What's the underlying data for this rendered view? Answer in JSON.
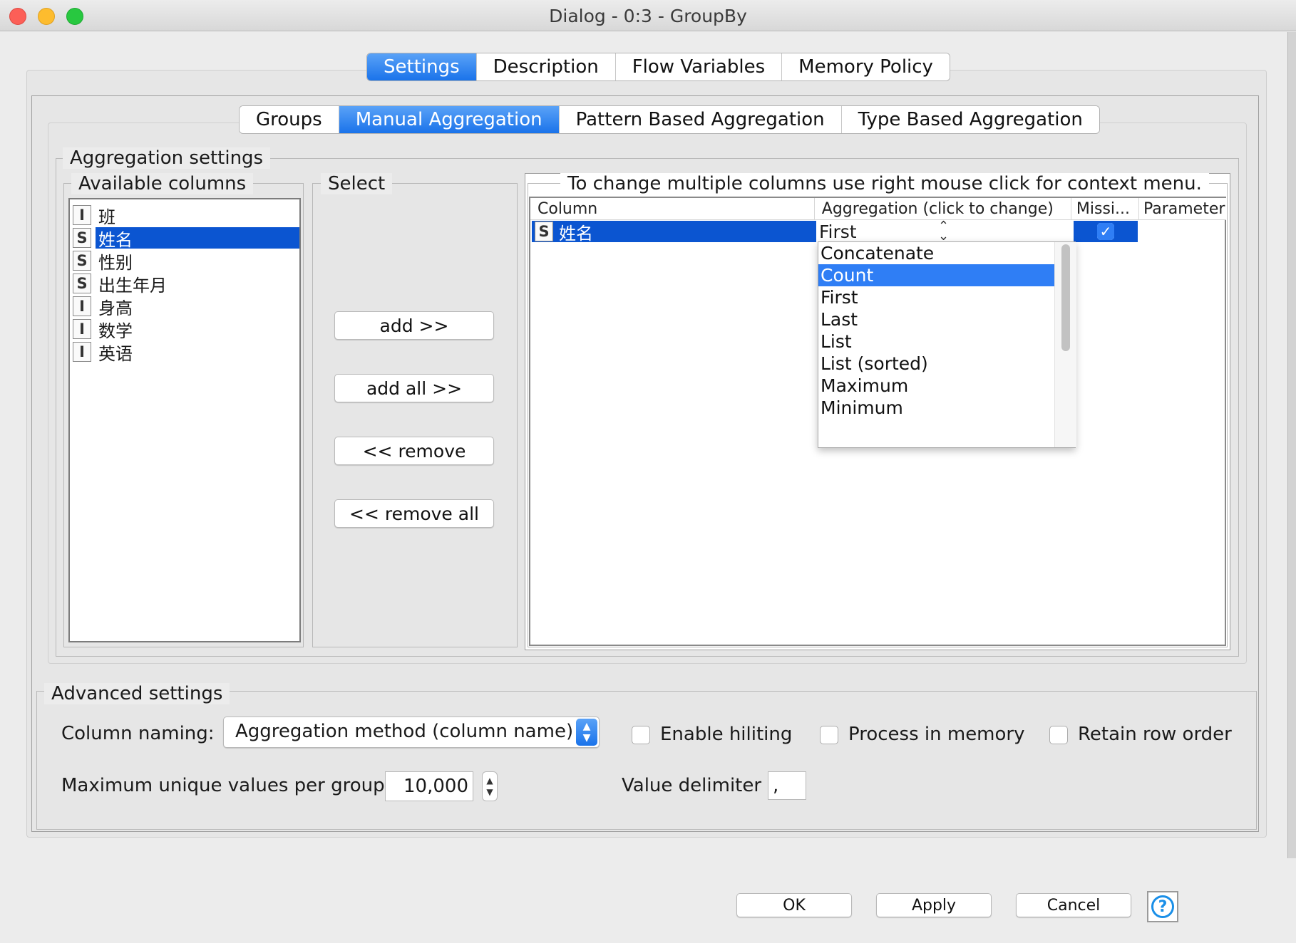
{
  "window": {
    "title": "Dialog - 0:3 - GroupBy"
  },
  "main_tabs": [
    {
      "label": "Settings",
      "active": true
    },
    {
      "label": "Description",
      "active": false
    },
    {
      "label": "Flow Variables",
      "active": false
    },
    {
      "label": "Memory Policy",
      "active": false
    }
  ],
  "sub_tabs": [
    {
      "label": "Groups",
      "active": false
    },
    {
      "label": "Manual Aggregation",
      "active": true
    },
    {
      "label": "Pattern Based Aggregation",
      "active": false
    },
    {
      "label": "Type Based Aggregation",
      "active": false
    }
  ],
  "aggregation_settings": {
    "legend": "Aggregation settings",
    "available_columns": {
      "legend": "Available columns",
      "items": [
        {
          "type": "I",
          "name": "班",
          "selected": false
        },
        {
          "type": "S",
          "name": "姓名",
          "selected": true
        },
        {
          "type": "S",
          "name": "性别",
          "selected": false
        },
        {
          "type": "S",
          "name": "出生年月",
          "selected": false
        },
        {
          "type": "I",
          "name": "身高",
          "selected": false
        },
        {
          "type": "I",
          "name": "数学",
          "selected": false
        },
        {
          "type": "I",
          "name": "英语",
          "selected": false
        }
      ]
    },
    "select": {
      "legend": "Select",
      "add": "add >>",
      "add_all": "add all >>",
      "remove": "<< remove",
      "remove_all": "<< remove all"
    },
    "table": {
      "legend": "To change multiple columns use right mouse click for context menu.",
      "headers": {
        "column": "Column",
        "aggregation": "Aggregation (click to change)",
        "missing": "Missi...",
        "parameter": "Parameter"
      },
      "row": {
        "type": "S",
        "column": "姓名",
        "aggregation": "First",
        "missing_checked": true
      },
      "dropdown_options": [
        "Concatenate",
        "Count",
        "First",
        "Last",
        "List",
        "List (sorted)",
        "Maximum",
        "Minimum"
      ],
      "highlighted_option": "Count"
    }
  },
  "advanced_settings": {
    "legend": "Advanced settings",
    "column_naming_label": "Column naming:",
    "column_naming_value": "Aggregation method (column name)",
    "enable_hiliting": "Enable hiliting",
    "process_in_memory": "Process in memory",
    "retain_row_order": "Retain row order",
    "max_unique_label": "Maximum unique values per group",
    "max_unique_value": "10,000",
    "value_delimiter_label": "Value delimiter",
    "value_delimiter_value": ","
  },
  "buttons": {
    "ok": "OK",
    "apply": "Apply",
    "cancel": "Cancel",
    "help": "?"
  },
  "colors": {
    "accent": "#1a73ea",
    "selection": "#0b55d1",
    "highlight": "#2f7ef5"
  }
}
